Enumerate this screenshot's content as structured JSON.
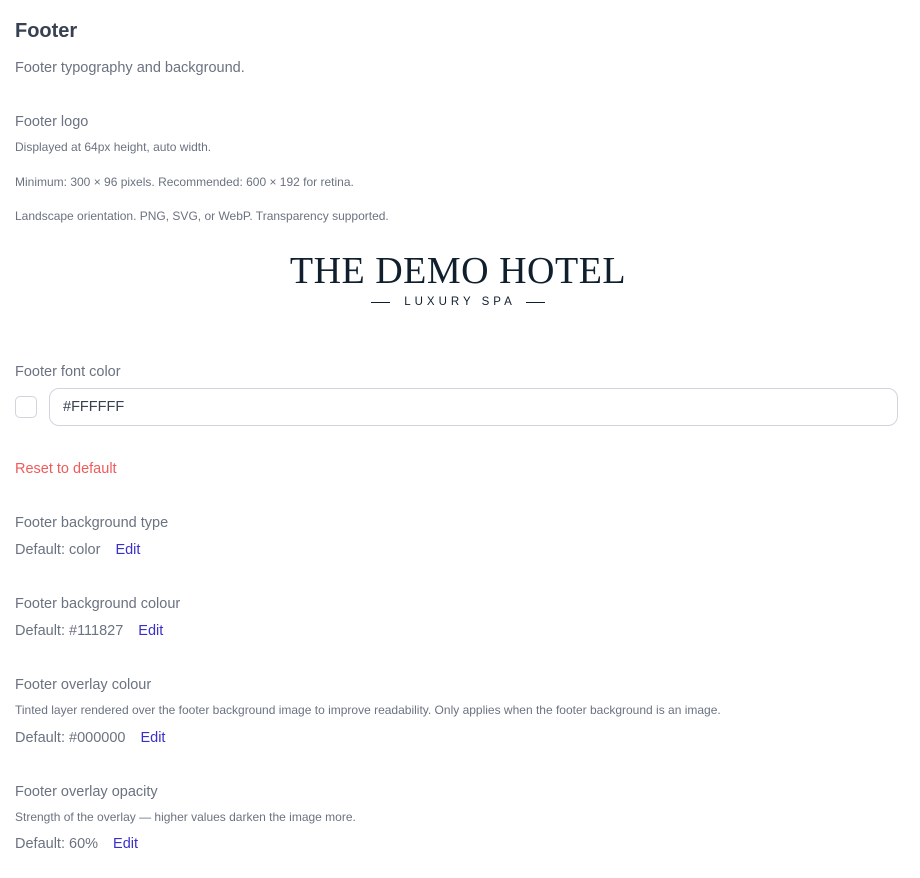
{
  "section": {
    "title": "Footer",
    "description": "Footer typography and background."
  },
  "logo": {
    "label": "Footer logo",
    "help_1": "Displayed at 64px height, auto width.",
    "help_2": "Minimum: 300 × 96 pixels. Recommended: 600 × 192 for retina.",
    "help_3": "Landscape orientation. PNG, SVG, or WebP. Transparency supported.",
    "preview_title": "THE DEMO HOTEL",
    "preview_subtitle": "LUXURY SPA"
  },
  "font_color": {
    "label": "Footer font color",
    "value": "#FFFFFF",
    "swatch_color": "#FFFFFF",
    "reset_label": "Reset to default"
  },
  "bg_type": {
    "label": "Footer background type",
    "default_text": "Default: color",
    "edit_label": "Edit"
  },
  "bg_colour": {
    "label": "Footer background colour",
    "default_text": "Default: #111827",
    "edit_label": "Edit"
  },
  "overlay_colour": {
    "label": "Footer overlay colour",
    "help": "Tinted layer rendered over the footer background image to improve readability. Only applies when the footer background is an image.",
    "default_text": "Default: #000000",
    "edit_label": "Edit"
  },
  "overlay_opacity": {
    "label": "Footer overlay opacity",
    "help": "Strength of the overlay — higher values darken the image more.",
    "default_text": "Default: 60%",
    "edit_label": "Edit"
  }
}
